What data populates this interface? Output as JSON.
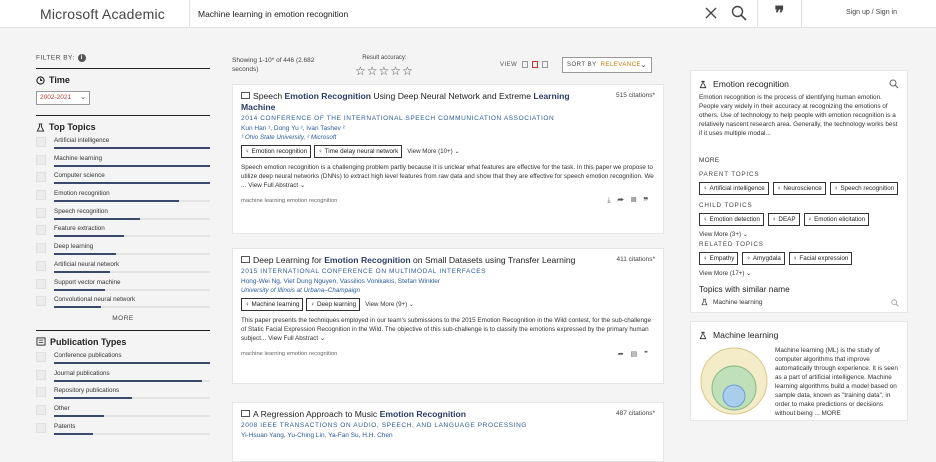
{
  "header": {
    "brand": "Microsoft Academic",
    "search_value": "Machine learning in emotion recognition",
    "signin": "Sign up / Sign in"
  },
  "filters": {
    "filter_by": "FILTER BY:",
    "time_title": "Time",
    "year_range": "2002-2021",
    "top_topics_title": "Top Topics",
    "topics": [
      {
        "label": "Artificial intelligence",
        "level": 1.0
      },
      {
        "label": "Machine learning",
        "level": 1.0
      },
      {
        "label": "Computer science",
        "level": 1.0
      },
      {
        "label": "Emotion recognition",
        "level": 0.8
      },
      {
        "label": "Speech recognition",
        "level": 0.55
      },
      {
        "label": "Feature extraction",
        "level": 0.45
      },
      {
        "label": "Deep learning",
        "level": 0.4
      },
      {
        "label": "Artificial neural network",
        "level": 0.36
      },
      {
        "label": "Support vector machine",
        "level": 0.33
      },
      {
        "label": "Convolutional neural network",
        "level": 0.3
      }
    ],
    "more": "MORE",
    "pub_types_title": "Publication Types",
    "pub_types": [
      {
        "label": "Conference publications",
        "level": 1.0
      },
      {
        "label": "Journal publications",
        "level": 0.95
      },
      {
        "label": "Repository publications",
        "level": 0.5
      },
      {
        "label": "Other",
        "level": 0.32
      },
      {
        "label": "Patents",
        "level": 0.25
      }
    ]
  },
  "results": {
    "showing": "Showing 1-10* of 446 (2.682 seconds)",
    "accuracy_label": "Result accuracy:",
    "stars": "☆☆☆☆☆",
    "view_label": "VIEW",
    "sort_label": "SORT BY",
    "sort_value": "RELEVANCE",
    "papers": [
      {
        "title_pre": "Speech ",
        "title_hl": "Emotion Recognition",
        "title_post": " Using Deep Neural Network and Extreme ",
        "title_hl2": "Learning Machine",
        "citations": "515 citations*",
        "venue": "2014 CONFERENCE OF THE INTERNATIONAL SPEECH COMMUNICATION ASSOCIATION",
        "authors": "Kun Han ¹,   Dong Yu ²,   Ivan Tashev ²",
        "affil": "¹ Ohio State University,   ² Microsoft",
        "tags": [
          "Emotion recognition",
          "Time delay neural network"
        ],
        "view_more": "View More (10+)",
        "abstract": "Speech emotion recognition is a challenging problem partly because it is unclear what features are effective for the task. In this paper we propose to utilize deep neural networks (DNNs) to extract high level features from raw data and show that they are effective for speech emotion recognition. We ...",
        "view_abstract": "View Full Abstract",
        "keywords": "machine   learning   emotion recognition"
      },
      {
        "title_pre": "Deep Learning for ",
        "title_hl": "Emotion Recognition",
        "title_post": " on Small Datasets using Transfer Learning",
        "title_hl2": "",
        "citations": "411 citations*",
        "venue": "2015 INTERNATIONAL CONFERENCE ON MULTIMODAL INTERFACES",
        "authors": "Hong-Wei Ng,   Viet Dung Nguyen,   Vassilios Vonikakis,   Stefan Winkler",
        "affil": "University of Illinois at Urbana–Champaign",
        "tags": [
          "Machine learning",
          "Deep learning"
        ],
        "view_more": "View More (9+)",
        "abstract": "This paper presents the techniques employed in our team's submissions to the 2015 Emotion Recognition in the Wild contest, for the sub-challenge of Static Facial Expression Recognition in the Wild. The objective of this sub-challenge is to classify the emotions expressed by the primary human subject...",
        "view_abstract": "View Full Abstract",
        "keywords": "machine learning   emotion   recognition"
      },
      {
        "title_pre": "A Regression Approach to Music ",
        "title_hl": "Emotion Recognition",
        "title_post": "",
        "title_hl2": "",
        "citations": "487 citations*",
        "venue": "2008 IEEE TRANSACTIONS ON AUDIO, SPEECH, AND LANGUAGE PROCESSING",
        "authors": "Yi-Hsuan Yang,   Yu-Ching Lin,   Ya-Fan Su,   H.H. Chen",
        "affil": "",
        "tags": [],
        "view_more": "",
        "abstract": "",
        "view_abstract": "",
        "keywords": ""
      }
    ]
  },
  "topic_panel": {
    "title": "Emotion recognition",
    "description": "Emotion recognition is the process of identifying human emotion. People vary widely in their accuracy at recognizing the emotions of others. Use of technology to help people with emotion recognition is a relatively nascent research area. Generally, the technology works best if it uses multiple modal...",
    "more": "MORE",
    "parent_label": "PARENT TOPICS",
    "parents": [
      "Artificial intelligence",
      "Neuroscience",
      "Speech recognition"
    ],
    "child_label": "CHILD TOPICS",
    "children": [
      "Emotion detection",
      "DEAP",
      "Emotion elicitation"
    ],
    "child_more": "View More (3+)",
    "related_label": "RELATED TOPICS",
    "related": [
      "Empathy",
      "Amygdala",
      "Facial expression"
    ],
    "related_more": "View More (17+)",
    "similar_title": "Topics with similar name",
    "similar_item": "Machine learning"
  },
  "ml_panel": {
    "title": "Machine learning",
    "description": "Machine learning (ML) is the study of computer algorithms that improve automatically through experience. It is seen as a part of artificial intelligence. Machine learning algorithms build a model based on sample data, known as \"training data\", in order to make predictions or decisions without being ... MORE"
  }
}
